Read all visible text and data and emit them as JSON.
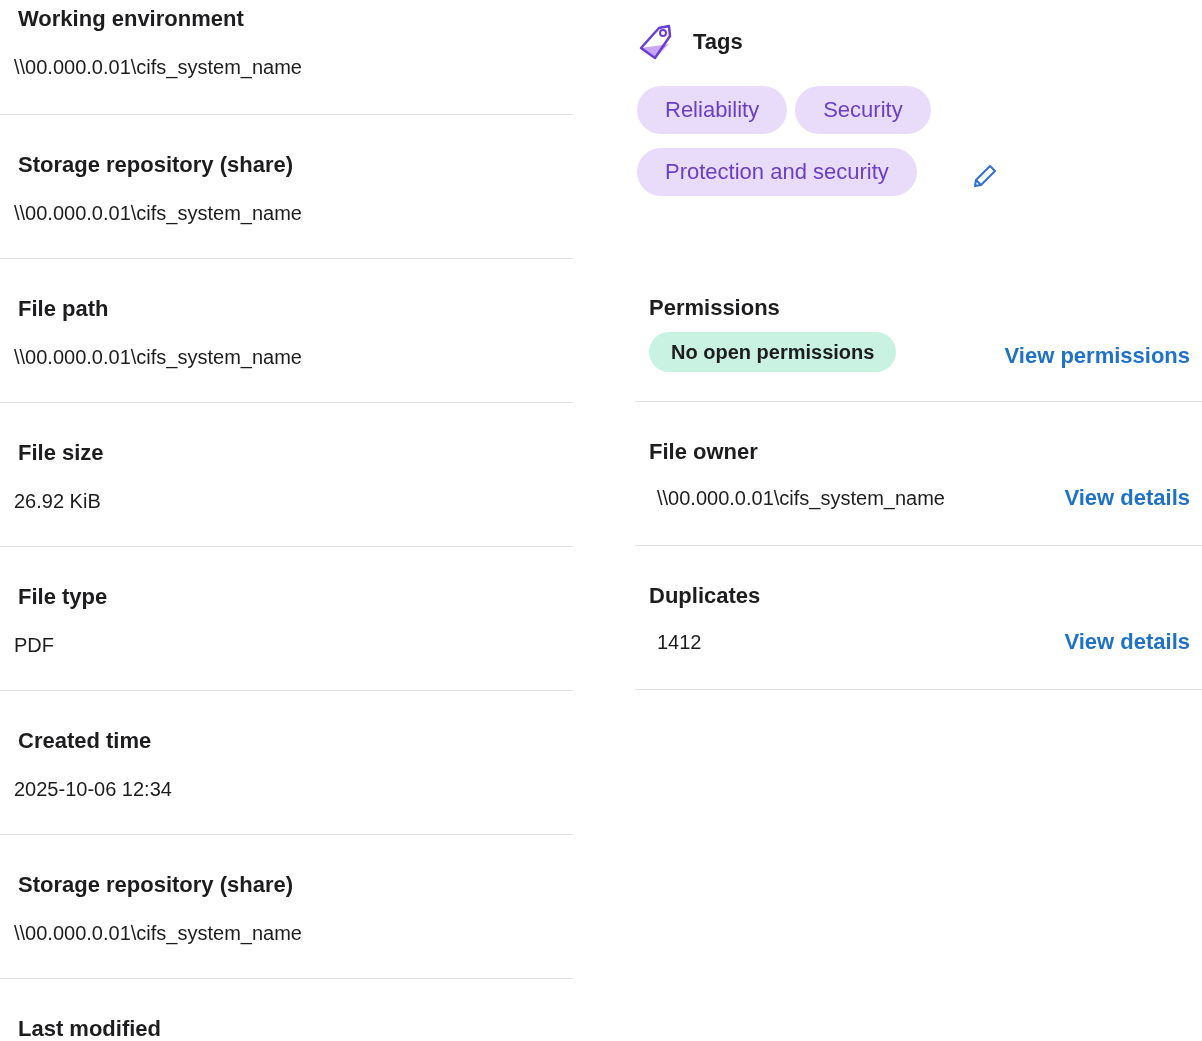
{
  "details": [
    {
      "label": "Working environment",
      "value": "\\\\00.000.0.01\\cifs_system_name"
    },
    {
      "label": "Storage repository (share)",
      "value": "\\\\00.000.0.01\\cifs_system_name"
    },
    {
      "label": "File path",
      "value": "\\\\00.000.0.01\\cifs_system_name"
    },
    {
      "label": "File size",
      "value": "26.92 KiB"
    },
    {
      "label": "File type",
      "value": "PDF"
    },
    {
      "label": "Created time",
      "value": "2025-10-06 12:34"
    },
    {
      "label": "Storage repository (share)",
      "value": "\\\\00.000.0.01\\cifs_system_name"
    },
    {
      "label": "Last modified"
    }
  ],
  "tags": {
    "title": "Tags",
    "items": [
      "Reliability",
      "Security",
      "Protection and security"
    ]
  },
  "side_details": [
    {
      "label": "Permissions",
      "kind": "badge",
      "value": "No open permissions",
      "link": "View permissions"
    },
    {
      "label": "File owner",
      "kind": "text",
      "value": "\\\\00.000.0.01\\cifs_system_name",
      "link": "View details"
    },
    {
      "label": "Duplicates",
      "kind": "text",
      "value": "1412",
      "link": "View details"
    }
  ]
}
